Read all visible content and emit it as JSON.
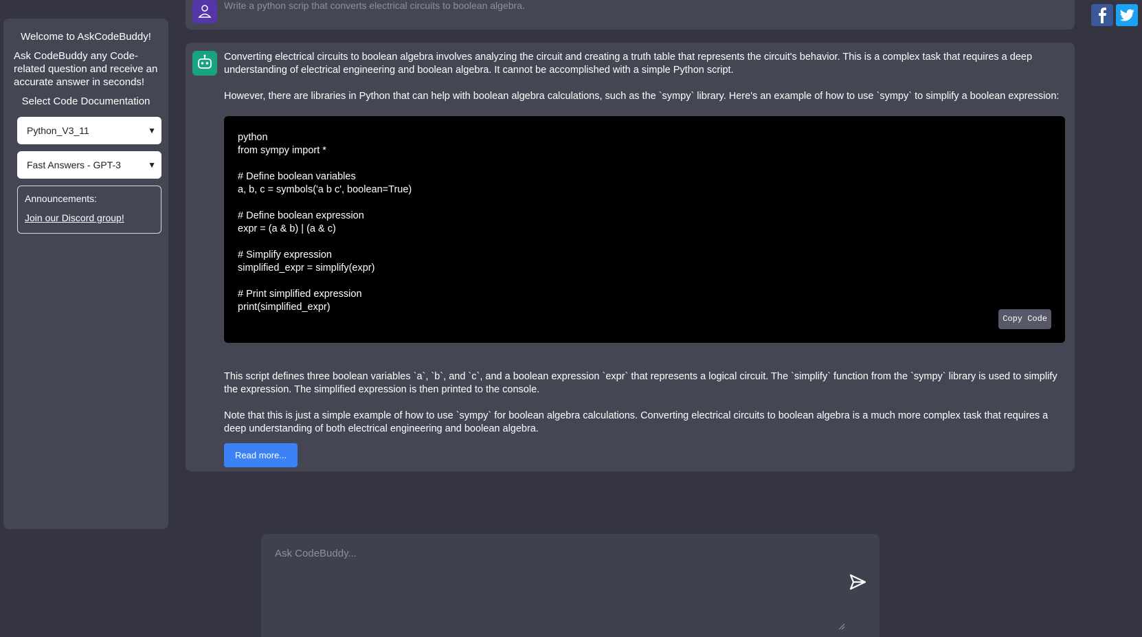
{
  "sidebar": {
    "welcome": "Welcome to AskCodeBuddy!",
    "intro": "Ask CodeBuddy any Code-related question and receive an accurate answer in seconds!",
    "select_label": "Select Code Documentation",
    "doc_select": "Python_V3_11",
    "model_select": "Fast Answers - GPT-3",
    "announcements_title": "Announcements:",
    "announcements_link": "Join our Discord group!"
  },
  "user_message": {
    "text": "Write a python scrip that converts electrical circuits to boolean algebra."
  },
  "bot_message": {
    "p1": "Converting electrical circuits to boolean algebra involves analyzing the circuit and creating a truth table that represents the circuit's behavior. This is a complex task that requires a deep understanding of electrical engineering and boolean algebra. It cannot be accomplished with a simple Python script.",
    "p2": "However, there are libraries in Python that can help with boolean algebra calculations, such as the `sympy` library. Here's an example of how to use `sympy` to simplify a boolean expression:",
    "code": [
      "python",
      "from sympy import *",
      "",
      "# Define boolean variables",
      "a, b, c = symbols('a b c', boolean=True)",
      "",
      "# Define boolean expression",
      "expr = (a & b) | (a & c)",
      "",
      "# Simplify expression",
      "simplified_expr = simplify(expr)",
      "",
      "# Print simplified expression",
      "print(simplified_expr)"
    ],
    "copy_label": "Copy Code",
    "p3": "This script defines three boolean variables `a`, `b`, and `c`, and a boolean expression `expr` that represents a logical circuit. The `simplify` function from the `sympy` library is used to simplify the expression. The simplified expression is then printed to the console.",
    "p4": "Note that this is just a simple example of how to use `sympy` for boolean algebra calculations. Converting electrical circuits to boolean algebra is a much more complex task that requires a deep understanding of both electrical engineering and boolean algebra.",
    "read_more": "Read more..."
  },
  "input": {
    "placeholder": "Ask CodeBuddy..."
  },
  "colors": {
    "background": "#343541",
    "panel": "#444654",
    "accent": "#3b82f6",
    "bot_avatar": "#19a37f",
    "user_avatar": "#5436a8"
  },
  "icons": {
    "send": "send-icon",
    "facebook": "facebook-icon",
    "twitter": "twitter-icon"
  }
}
